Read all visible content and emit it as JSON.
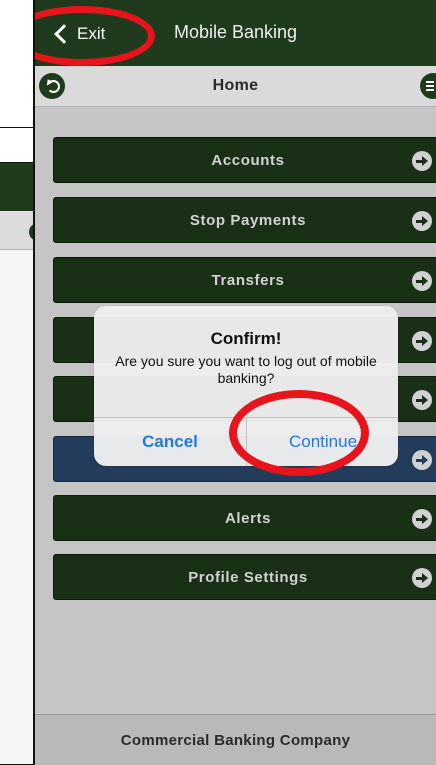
{
  "app": {
    "title": "Mobile Banking",
    "exit_label": "Exit",
    "page_title": "Home"
  },
  "nav": {
    "items": [
      {
        "label": "Accounts"
      },
      {
        "label": "Stop Payments"
      },
      {
        "label": "Transfers"
      },
      {
        "label": ""
      },
      {
        "label": ""
      },
      {
        "label": ""
      },
      {
        "label": "Alerts"
      },
      {
        "label": "Profile Settings"
      }
    ]
  },
  "dialog": {
    "title": "Confirm!",
    "message": "Are you sure you want to log out of mobile banking?",
    "cancel_label": "Cancel",
    "continue_label": "Continue"
  },
  "footer": {
    "company": "Commercial Banking Company"
  },
  "colors": {
    "header": "#1f3a1c",
    "highlight_row": "#2c4a70",
    "annotation": "#e8141b",
    "link": "#1f7ae0"
  },
  "icons": {
    "exit": "chevron-left-icon",
    "back": "back-icon",
    "menu": "hamburger-menu-icon",
    "row_arrow": "arrow-right-icon"
  }
}
